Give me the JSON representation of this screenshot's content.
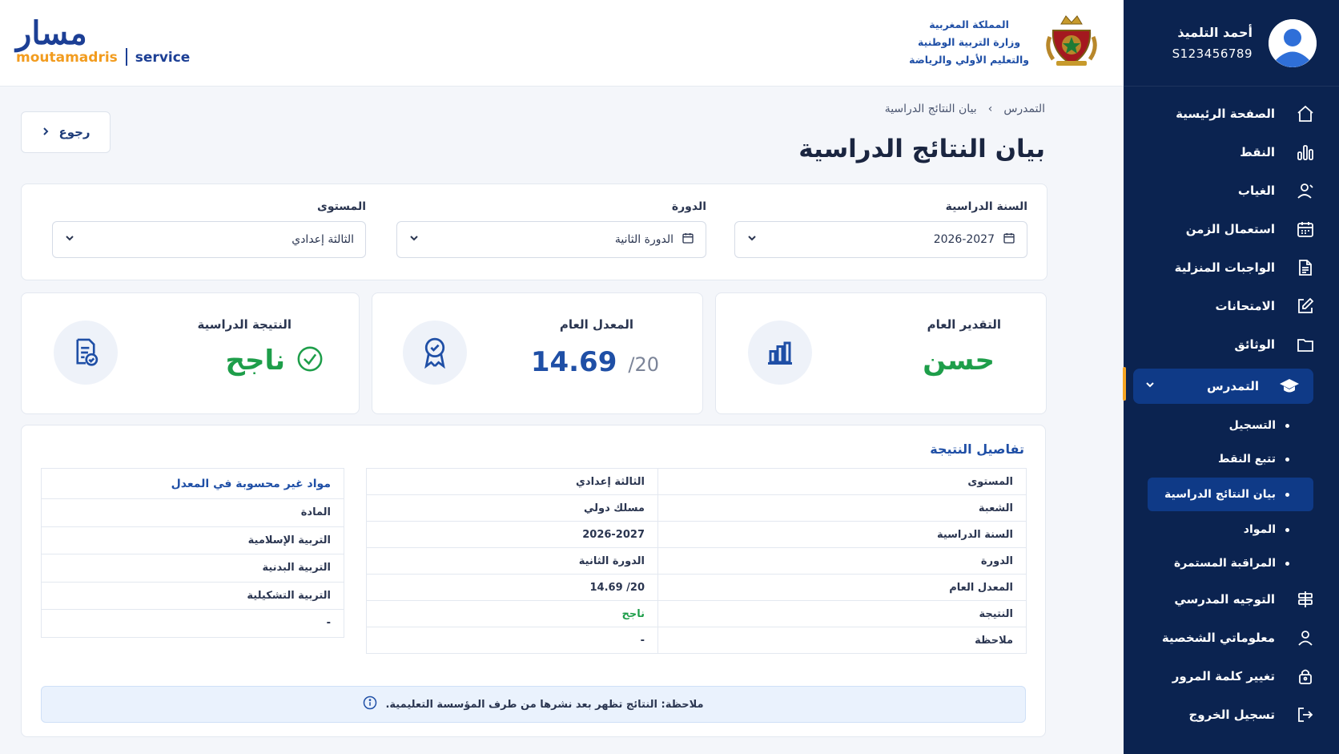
{
  "header": {
    "ministry_line1": "المملكة المغربية",
    "ministry_line2": "وزارة التربية الوطنية",
    "ministry_line3": "والتعليم الأولي والرياضة",
    "logo_ar": "مسار",
    "logo_sub": "moutamadris",
    "logo_service": "service",
    "emblem_icon": "royal-emblem"
  },
  "profile": {
    "name": "أحمد التلميذ",
    "id": "S123456789"
  },
  "sidebar": {
    "items": [
      {
        "label": "الصفحة الرئيسية",
        "icon": "home-icon"
      },
      {
        "label": "النقط",
        "icon": "bar-chart-icon"
      },
      {
        "label": "الغياب",
        "icon": "user-absence-icon"
      },
      {
        "label": "استعمال الزمن",
        "icon": "calendar-icon"
      },
      {
        "label": "الواجبات المنزلية",
        "icon": "document-icon"
      },
      {
        "label": "الامتحانات",
        "icon": "edit-icon"
      },
      {
        "label": "الوثائق",
        "icon": "folder-icon"
      },
      {
        "label": "التمدرس",
        "icon": "graduation-cap-icon"
      }
    ],
    "sub_items": [
      {
        "label": "التسجيل"
      },
      {
        "label": "تتبع النقط"
      },
      {
        "label": "بيان النتائج الدراسية"
      },
      {
        "label": "المواد"
      },
      {
        "label": "المراقبة المستمرة"
      }
    ],
    "bottom_items": [
      {
        "label": "التوجيه المدرسي",
        "icon": "signpost-icon"
      },
      {
        "label": "معلوماتي الشخصية",
        "icon": "user-icon"
      },
      {
        "label": "تغيير كلمة المرور",
        "icon": "lock-icon"
      },
      {
        "label": "تسجيل الخروج",
        "icon": "logout-icon"
      }
    ]
  },
  "page": {
    "back_label": "رجوع",
    "breadcrumb_parent": "التمدرس",
    "breadcrumb_sep": "›",
    "breadcrumb_current": "بيان النتائج الدراسية",
    "title": "بيان النتائج الدراسية"
  },
  "filters": {
    "year_label": "السنة الدراسية",
    "year_value": "2026-2027",
    "session_label": "الدورة",
    "session_value": "الدورة الثانية",
    "level_label": "المستوى",
    "level_value": "الثالثة إعدادي"
  },
  "stats": {
    "appreciation_label": "التقدير العام",
    "appreciation_value": "حسن",
    "average_label": "المعدل العام",
    "average_value": "14.69",
    "average_scale": "/20",
    "result_label": "النتيجة الدراسية",
    "result_value": "ناجح",
    "colors": {
      "success": "#1e9e4a",
      "primary": "#1f4fa6"
    }
  },
  "details": {
    "title": "تفاصيل النتيجة",
    "rows": [
      {
        "key": "المستوى",
        "value": "الثالثة إعدادي"
      },
      {
        "key": "الشعبة",
        "value": "مسلك دولي"
      },
      {
        "key": "السنة الدراسية",
        "value": "2026-2027"
      },
      {
        "key": "الدورة",
        "value": "الدورة الثانية"
      },
      {
        "key": "المعدل العام",
        "value": "14.69 /20"
      },
      {
        "key": "النتيجة",
        "value": "ناجح"
      },
      {
        "key": "ملاحظة",
        "value": "-"
      }
    ],
    "excluded_title": "مواد غير محسوبة في المعدل",
    "excluded_header": "المادة",
    "excluded_rows": [
      "التربية الإسلامية",
      "التربية البدنية",
      "التربية التشكيلية",
      "-"
    ],
    "note": "ملاحظة: النتائج تظهر بعد نشرها من طرف المؤسسة التعليمية."
  }
}
